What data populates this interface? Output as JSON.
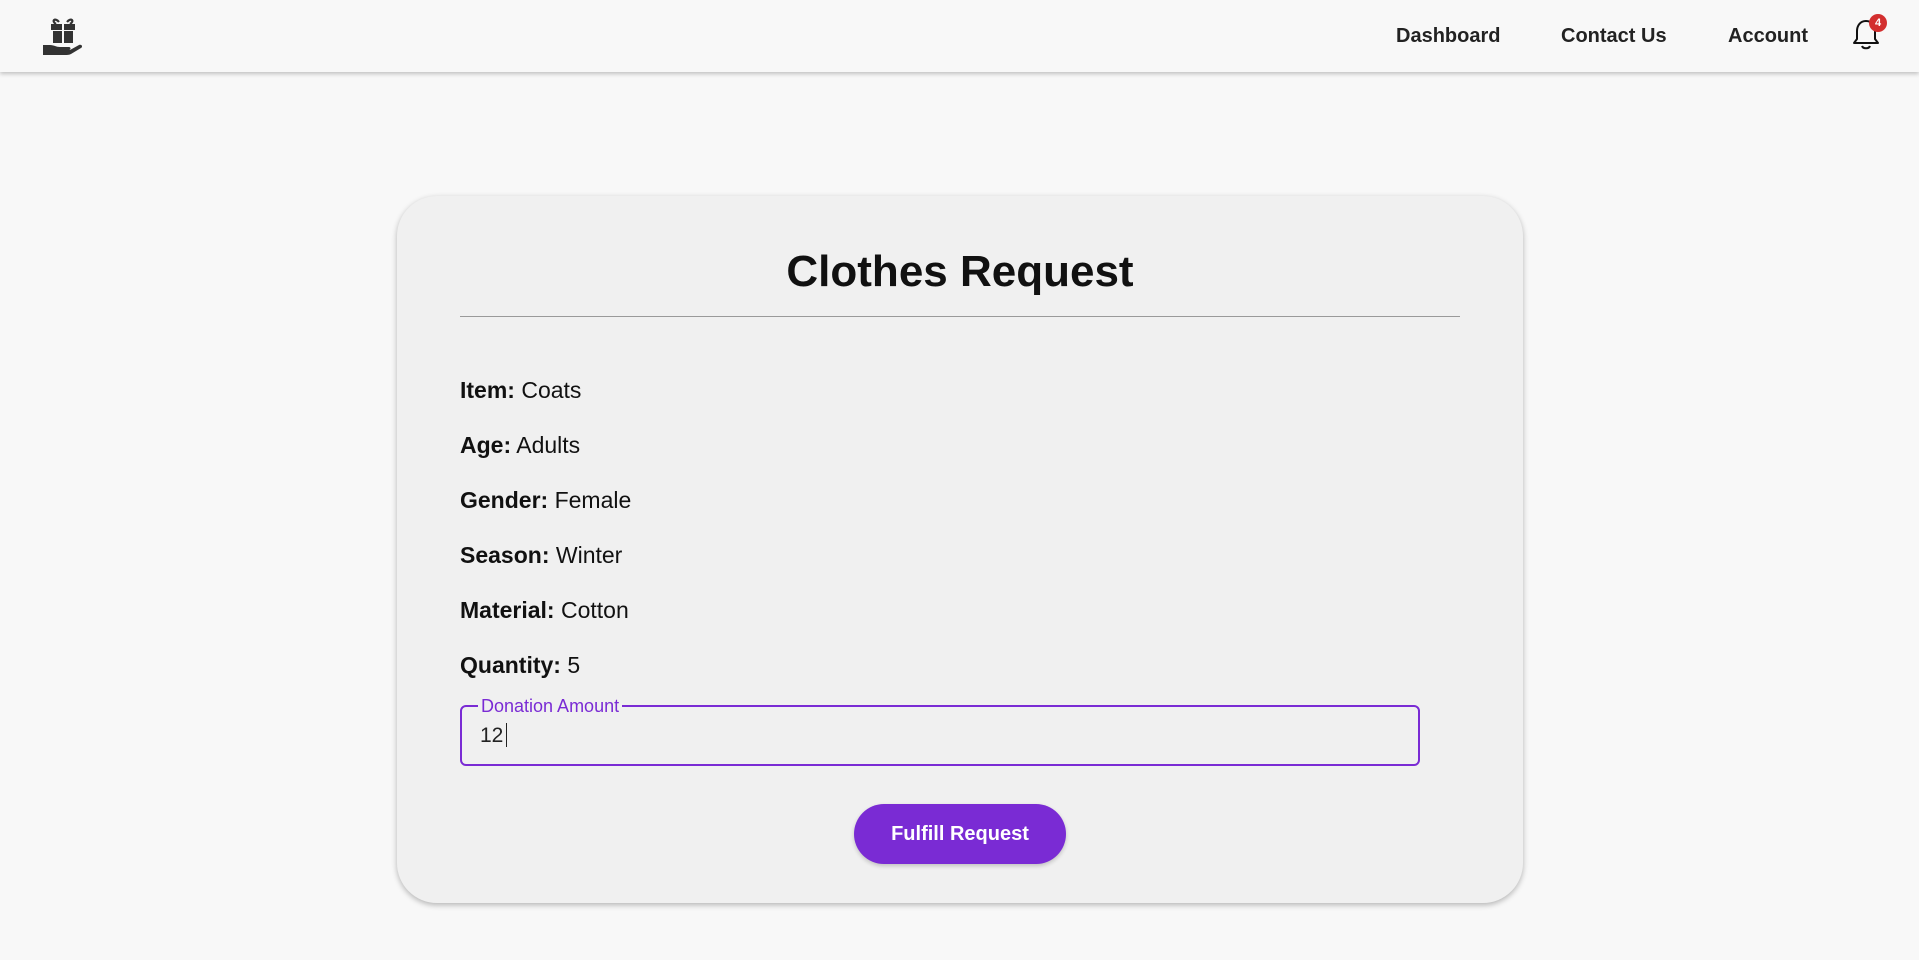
{
  "nav": {
    "logo_icon": "gift-in-hand-icon",
    "links": {
      "dashboard": "Dashboard",
      "contact": "Contact Us",
      "account": "Account"
    },
    "notifications": {
      "icon": "bell-icon",
      "count": "4"
    }
  },
  "request": {
    "title": "Clothes Request",
    "fields": {
      "item": {
        "label": "Item:",
        "value": "Coats"
      },
      "age": {
        "label": "Age:",
        "value": "Adults"
      },
      "gender": {
        "label": "Gender:",
        "value": "Female"
      },
      "season": {
        "label": "Season:",
        "value": "Winter"
      },
      "material": {
        "label": "Material:",
        "value": "Cotton"
      },
      "quantity": {
        "label": "Quantity:",
        "value": "5"
      }
    },
    "donation": {
      "label": "Donation Amount",
      "value": "12"
    },
    "submit_label": "Fulfill Request"
  },
  "colors": {
    "accent": "#7a2bd4",
    "badge": "#d32f2f",
    "card_bg": "#f0f0f0",
    "page_bg": "#f8f8f8"
  }
}
